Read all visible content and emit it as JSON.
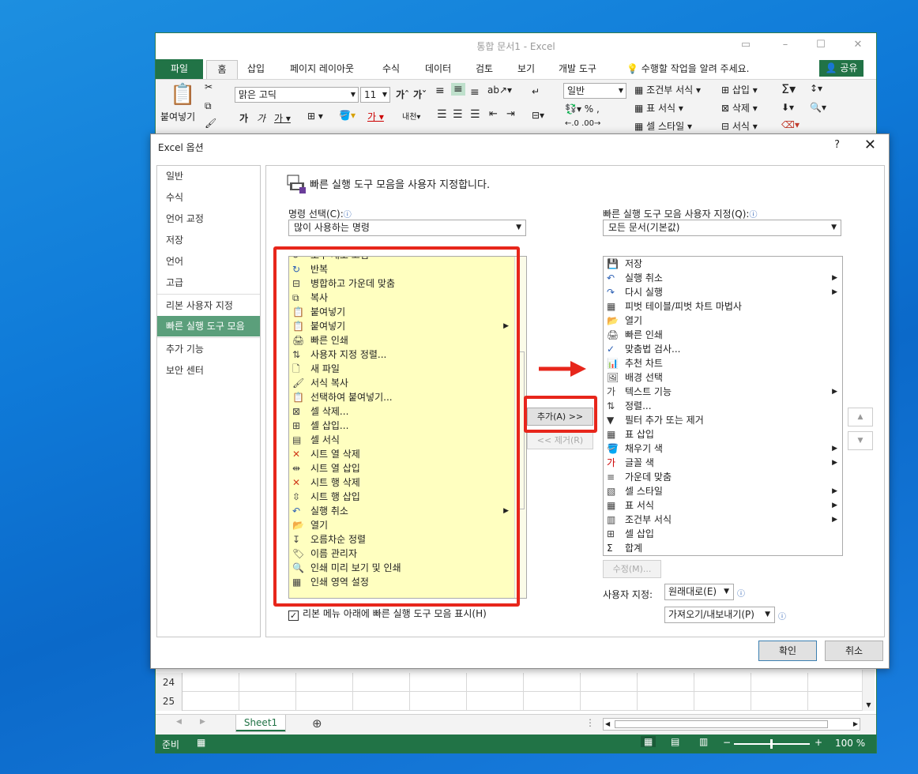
{
  "excel": {
    "title": "통합 문서1 - Excel",
    "tabs": [
      "파일",
      "홈",
      "삽입",
      "페이지 레이아웃",
      "수식",
      "데이터",
      "검토",
      "보기",
      "개발 도구"
    ],
    "tell_me": "수행할 작업을 알려 주세요.",
    "share": "공유",
    "ribbon": {
      "paste_label": "붙여넣기",
      "font_name": "맑은 고딕",
      "font_size": "11",
      "number_format": "일반",
      "conditional_format": "조건부 서식",
      "table_format": "표 서식",
      "cell_style": "셀 스타일",
      "insert": "삽입",
      "delete": "삭제",
      "format": "서식"
    },
    "rows": [
      "24",
      "25"
    ],
    "sheet_tab": "Sheet1",
    "status": "준비",
    "zoom": "100 %"
  },
  "dialog": {
    "title": "Excel 옵션",
    "help": "?",
    "nav": [
      "일반",
      "수식",
      "언어 교정",
      "저장",
      "언어",
      "고급",
      "리본 사용자 지정",
      "빠른 실행 도구 모음",
      "추가 기능",
      "보안 센터"
    ],
    "heading": "빠른 실행 도구 모음을 사용자 지정합니다.",
    "choose_label": "명령 선택(C):",
    "choose_value": "많이 사용하는 명령",
    "customize_label": "빠른 실행 도구 모음 사용자 지정(Q):",
    "customize_value": "모든 문서(기본값)",
    "left_items": [
      {
        "label": "모두 새로 고침",
        "icon": "refresh-all-icon",
        "sub": false
      },
      {
        "label": "반복",
        "icon": "repeat-icon",
        "sub": false
      },
      {
        "label": "병합하고 가운데 맞춤",
        "icon": "merge-center-icon",
        "sub": false
      },
      {
        "label": "복사",
        "icon": "copy-icon",
        "sub": false
      },
      {
        "label": "붙여넣기",
        "icon": "paste-icon",
        "sub": false
      },
      {
        "label": "붙여넣기",
        "icon": "paste-icon",
        "sub": true
      },
      {
        "label": "빠른 인쇄",
        "icon": "quick-print-icon",
        "sub": false
      },
      {
        "label": "사용자 지정 정렬...",
        "icon": "custom-sort-icon",
        "sub": false
      },
      {
        "label": "새 파일",
        "icon": "new-file-icon",
        "sub": false
      },
      {
        "label": "서식 복사",
        "icon": "format-painter-icon",
        "sub": false
      },
      {
        "label": "선택하여 붙여넣기...",
        "icon": "paste-special-icon",
        "sub": false
      },
      {
        "label": "셀 삭제...",
        "icon": "delete-cells-icon",
        "sub": false
      },
      {
        "label": "셀 삽입...",
        "icon": "insert-cells-icon",
        "sub": false
      },
      {
        "label": "셀 서식",
        "icon": "format-cells-icon",
        "sub": false
      },
      {
        "label": "시트 열 삭제",
        "icon": "delete-column-icon",
        "sub": false
      },
      {
        "label": "시트 열 삽입",
        "icon": "insert-column-icon",
        "sub": false
      },
      {
        "label": "시트 행 삭제",
        "icon": "delete-row-icon",
        "sub": false
      },
      {
        "label": "시트 행 삽입",
        "icon": "insert-row-icon",
        "sub": false
      },
      {
        "label": "실행 취소",
        "icon": "undo-icon",
        "sub": true
      },
      {
        "label": "열기",
        "icon": "open-folder-icon",
        "sub": false
      },
      {
        "label": "오름차순 정렬",
        "icon": "sort-ascending-icon",
        "sub": false
      },
      {
        "label": "이름 관리자",
        "icon": "name-manager-icon",
        "sub": false
      },
      {
        "label": "인쇄 미리 보기 및 인쇄",
        "icon": "print-preview-icon",
        "sub": false
      },
      {
        "label": "인쇄 영역 설정",
        "icon": "print-area-icon",
        "sub": false
      }
    ],
    "right_items": [
      {
        "label": "저장",
        "icon": "save-icon",
        "sub": false
      },
      {
        "label": "실행 취소",
        "icon": "undo-icon",
        "sub": true
      },
      {
        "label": "다시 실행",
        "icon": "redo-icon",
        "sub": true
      },
      {
        "label": "피벗 테이블/피벗 차트 마법사",
        "icon": "pivot-wizard-icon",
        "sub": false
      },
      {
        "label": "열기",
        "icon": "open-folder-icon",
        "sub": false
      },
      {
        "label": "빠른 인쇄",
        "icon": "quick-print-icon",
        "sub": false
      },
      {
        "label": "맞춤법 검사...",
        "icon": "spelling-icon",
        "sub": false
      },
      {
        "label": "추천 차트",
        "icon": "recommended-chart-icon",
        "sub": false
      },
      {
        "label": "배경 선택",
        "icon": "background-icon",
        "sub": false
      },
      {
        "label": "텍스트 기능",
        "icon": "text-icon",
        "sub": true
      },
      {
        "label": "정렬...",
        "icon": "sort-icon",
        "sub": false
      },
      {
        "label": "필터 추가 또는 제거",
        "icon": "filter-icon",
        "sub": false
      },
      {
        "label": "표 삽입",
        "icon": "insert-table-icon",
        "sub": false
      },
      {
        "label": "채우기 색",
        "icon": "fill-color-icon",
        "sub": true
      },
      {
        "label": "글꼴 색",
        "icon": "font-color-icon",
        "sub": true
      },
      {
        "label": "가운데 맞춤",
        "icon": "align-center-icon",
        "sub": false
      },
      {
        "label": "셀 스타일",
        "icon": "cell-style-icon",
        "sub": true
      },
      {
        "label": "표 서식",
        "icon": "table-format-icon",
        "sub": true
      },
      {
        "label": "조건부 서식",
        "icon": "conditional-format-icon",
        "sub": true
      },
      {
        "label": "셀 삽입",
        "icon": "insert-cells-icon",
        "sub": false
      },
      {
        "label": "합계",
        "icon": "sum-icon",
        "sub": false
      }
    ],
    "add_button": "추가(A) >>",
    "remove_button": "<< 제거(R)",
    "modify_button": "수정(M)...",
    "customize_prefix": "사용자 지정:",
    "reset_button": "원래대로(E)",
    "import_export_button": "가져오기/내보내기(P)",
    "show_below_ribbon": "리본 메뉴 아래에 빠른 실행 도구 모음 표시(H)",
    "ok": "확인",
    "cancel": "취소"
  },
  "colors": {
    "excel_green": "#217346",
    "highlight_red": "#e7261b",
    "nav_active": "#5b9f7b",
    "list_highlight": "#ffffc0"
  }
}
